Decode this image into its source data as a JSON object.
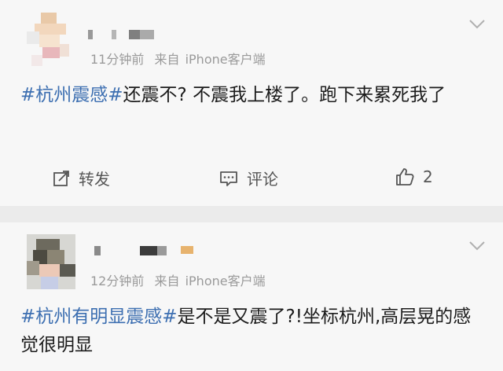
{
  "posts": [
    {
      "time": "11分钟前",
      "source_label": "来自",
      "source": "iPhone客户端",
      "hashtag": "#杭州震感#",
      "content": "还震不? 不震我上楼了。跑下来累死我了",
      "actions": {
        "repost_label": "转发",
        "comment_label": "评论",
        "like_count": "2"
      }
    },
    {
      "time": "12分钟前",
      "source_label": "来自",
      "source": "iPhone客户端",
      "hashtag": "#杭州有明显震感#",
      "content": "是不是又震了?!坐标杭州,高层晃的感觉很明显"
    }
  ],
  "icons": [
    "chevron-down-icon",
    "repost-icon",
    "comment-icon",
    "like-icon"
  ],
  "colors": {
    "hashtag": "#3d6fb1",
    "meta": "#9a9a9a",
    "card": "#f7f7f7",
    "divider": "#ebebeb"
  }
}
